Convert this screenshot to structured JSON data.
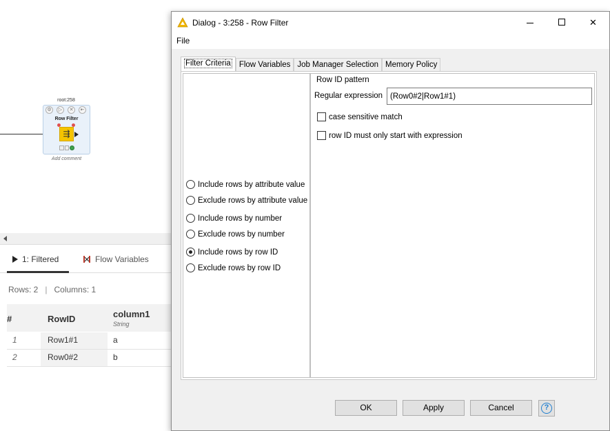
{
  "workflow": {
    "node_id": "root:258",
    "node_title": "Row Filter",
    "node_comment": "Add comment"
  },
  "output_panel": {
    "tabs": [
      {
        "label": "1: Filtered",
        "icon": "play-icon"
      },
      {
        "label": "Flow Variables",
        "icon": "flow-variable-icon"
      }
    ],
    "rows_info": "Rows: 2",
    "separator": "|",
    "columns_info": "Columns: 1",
    "table": {
      "headers": {
        "index": "#",
        "rowid": "RowID",
        "column1": "column1",
        "column1_type": "String"
      },
      "rows": [
        {
          "index": "1",
          "rowid": "Row1#1",
          "value": "a"
        },
        {
          "index": "2",
          "rowid": "Row0#2",
          "value": "b"
        }
      ]
    }
  },
  "dialog": {
    "title": "Dialog - 3:258 - Row Filter",
    "menu": {
      "file": "File"
    },
    "tabs": [
      "Filter Criteria",
      "Flow Variables",
      "Job Manager Selection",
      "Memory Policy"
    ],
    "active_tab": "Filter Criteria",
    "options": [
      {
        "label": "Include rows by attribute value",
        "selected": false
      },
      {
        "label": "Exclude rows by attribute value",
        "selected": false
      },
      {
        "label": "Include rows by number",
        "selected": false
      },
      {
        "label": "Exclude rows by number",
        "selected": false
      },
      {
        "label": "Include rows by row ID",
        "selected": true
      },
      {
        "label": "Exclude rows by row ID",
        "selected": false
      }
    ],
    "rowid_pattern": {
      "legend": "Row ID pattern",
      "regex_label": "Regular expression",
      "regex_value": "(Row0#2|Row1#1)",
      "case_sensitive_label": "case sensitive match",
      "case_sensitive_checked": false,
      "start_only_label": "row ID must only start with expression",
      "start_only_checked": false
    },
    "buttons": {
      "ok": "OK",
      "apply": "Apply",
      "cancel": "Cancel",
      "help": "?"
    },
    "window_controls": {
      "close": "✕"
    }
  },
  "colors": {
    "node_yellow": "#f5c400",
    "help_blue": "#1f7fd0",
    "status_green": "#3fa34d"
  }
}
